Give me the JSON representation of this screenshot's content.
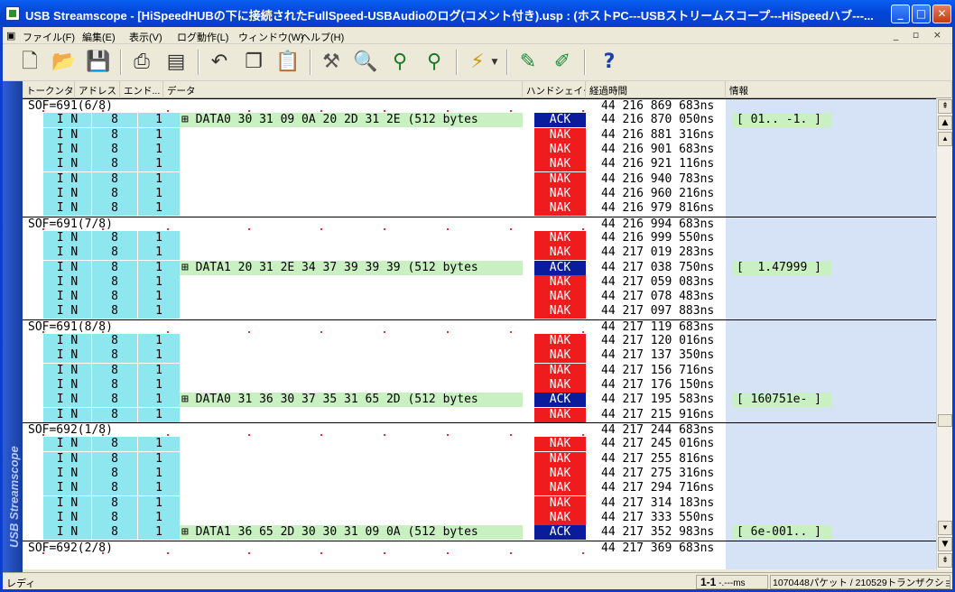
{
  "window": {
    "title": "USB Streamscope - [HiSpeedHUBの下に接続されたFullSpeed-USBAudioのログ(コメント付き).usp : (ホストPC---USBストリームスコープ---HiSpeedハブ---...",
    "min_label": "_",
    "max_label": "□",
    "close_label": "✕"
  },
  "menu": {
    "items": [
      "ファイル(F)",
      "編集(E)",
      "表示(V)",
      "ログ動作(L)",
      "ウィンドウ(W)",
      "ヘルプ(H)"
    ],
    "mdi_controls": "_ ▫ ×"
  },
  "toolbar": {
    "icons": [
      "new-icon",
      "open-icon",
      "save-icon",
      "print-icon",
      "print-preview-icon",
      "undo-icon",
      "copy-icon",
      "paste-icon",
      "filter-icon",
      "find-icon",
      "find-prev-icon",
      "find-next-icon",
      "trigger-icon",
      "mark-icon",
      "clear-mark-icon",
      "help-icon"
    ],
    "help_glyph": "?"
  },
  "sidebar": {
    "label": "USB Streamscope"
  },
  "columns": [
    "トークンタイプ",
    "アドレス",
    "エンド...",
    "データ",
    "ハンドシェイク",
    "経過時間",
    "情報"
  ],
  "rows": [
    {
      "kind": "sof",
      "label": "SOF=691(6/8)",
      "time": "44 216 869 683ns"
    },
    {
      "kind": "tx",
      "tok": "I N",
      "adr": "8",
      "end": "1",
      "data": "⊞ DATA0 30 31 09 0A 20 2D 31 2E (512 bytes",
      "hs": "ACK",
      "time": "44 216 870 050ns",
      "info": "[ 01.. -1. ]"
    },
    {
      "kind": "tx",
      "tok": "I N",
      "adr": "8",
      "end": "1",
      "hs": "NAK",
      "time": "44 216 881 316ns"
    },
    {
      "kind": "tx",
      "tok": "I N",
      "adr": "8",
      "end": "1",
      "hs": "NAK",
      "time": "44 216 901 683ns"
    },
    {
      "kind": "tx",
      "tok": "I N",
      "adr": "8",
      "end": "1",
      "hs": "NAK",
      "time": "44 216 921 116ns"
    },
    {
      "kind": "tx",
      "tok": "I N",
      "adr": "8",
      "end": "1",
      "hs": "NAK",
      "time": "44 216 940 783ns"
    },
    {
      "kind": "tx",
      "tok": "I N",
      "adr": "8",
      "end": "1",
      "hs": "NAK",
      "time": "44 216 960 216ns"
    },
    {
      "kind": "tx",
      "tok": "I N",
      "adr": "8",
      "end": "1",
      "hs": "NAK",
      "time": "44 216 979 816ns"
    },
    {
      "kind": "sof",
      "label": "SOF=691(7/8)",
      "time": "44 216 994 683ns"
    },
    {
      "kind": "tx",
      "tok": "I N",
      "adr": "8",
      "end": "1",
      "hs": "NAK",
      "time": "44 216 999 550ns"
    },
    {
      "kind": "tx",
      "tok": "I N",
      "adr": "8",
      "end": "1",
      "hs": "NAK",
      "time": "44 217 019 283ns"
    },
    {
      "kind": "tx",
      "tok": "I N",
      "adr": "8",
      "end": "1",
      "data": "⊞ DATA1 20 31 2E 34 37 39 39 39 (512 bytes",
      "hs": "ACK",
      "time": "44 217 038 750ns",
      "info": "[  1.47999 ]"
    },
    {
      "kind": "tx",
      "tok": "I N",
      "adr": "8",
      "end": "1",
      "hs": "NAK",
      "time": "44 217 059 083ns"
    },
    {
      "kind": "tx",
      "tok": "I N",
      "adr": "8",
      "end": "1",
      "hs": "NAK",
      "time": "44 217 078 483ns"
    },
    {
      "kind": "tx",
      "tok": "I N",
      "adr": "8",
      "end": "1",
      "hs": "NAK",
      "time": "44 217 097 883ns"
    },
    {
      "kind": "sof",
      "label": "SOF=691(8/8)",
      "time": "44 217 119 683ns"
    },
    {
      "kind": "tx",
      "tok": "I N",
      "adr": "8",
      "end": "1",
      "hs": "NAK",
      "time": "44 217 120 016ns"
    },
    {
      "kind": "tx",
      "tok": "I N",
      "adr": "8",
      "end": "1",
      "hs": "NAK",
      "time": "44 217 137 350ns"
    },
    {
      "kind": "tx",
      "tok": "I N",
      "adr": "8",
      "end": "1",
      "hs": "NAK",
      "time": "44 217 156 716ns"
    },
    {
      "kind": "tx",
      "tok": "I N",
      "adr": "8",
      "end": "1",
      "hs": "NAK",
      "time": "44 217 176 150ns"
    },
    {
      "kind": "tx",
      "tok": "I N",
      "adr": "8",
      "end": "1",
      "data": "⊞ DATA0 31 36 30 37 35 31 65 2D (512 bytes",
      "hs": "ACK",
      "time": "44 217 195 583ns",
      "info": "[ 160751e- ]"
    },
    {
      "kind": "tx",
      "tok": "I N",
      "adr": "8",
      "end": "1",
      "hs": "NAK",
      "time": "44 217 215 916ns"
    },
    {
      "kind": "sof",
      "label": "SOF=692(1/8)",
      "time": "44 217 244 683ns"
    },
    {
      "kind": "tx",
      "tok": "I N",
      "adr": "8",
      "end": "1",
      "hs": "NAK",
      "time": "44 217 245 016ns"
    },
    {
      "kind": "tx",
      "tok": "I N",
      "adr": "8",
      "end": "1",
      "hs": "NAK",
      "time": "44 217 255 816ns"
    },
    {
      "kind": "tx",
      "tok": "I N",
      "adr": "8",
      "end": "1",
      "hs": "NAK",
      "time": "44 217 275 316ns"
    },
    {
      "kind": "tx",
      "tok": "I N",
      "adr": "8",
      "end": "1",
      "hs": "NAK",
      "time": "44 217 294 716ns"
    },
    {
      "kind": "tx",
      "tok": "I N",
      "adr": "8",
      "end": "1",
      "hs": "NAK",
      "time": "44 217 314 183ns"
    },
    {
      "kind": "tx",
      "tok": "I N",
      "adr": "8",
      "end": "1",
      "hs": "NAK",
      "time": "44 217 333 550ns"
    },
    {
      "kind": "tx",
      "tok": "I N",
      "adr": "8",
      "end": "1",
      "data": "⊞ DATA1 36 65 2D 30 30 31 09 0A (512 bytes",
      "hs": "ACK",
      "time": "44 217 352 983ns",
      "info": "[ 6e-001.. ]"
    },
    {
      "kind": "sof",
      "label": "SOF=692(2/8)",
      "time": "44 217 369 683ns"
    }
  ],
  "colors": {
    "nak": "#ee1c1c",
    "ack": "#0a1c9c",
    "token": "#8ee6ee",
    "data": "#c8f0c0",
    "info_bg": "#d6e3f6"
  },
  "status": {
    "left": "レディ",
    "position_bold": "1-1",
    "position_suffix": " -.---ms",
    "counts": "1070448パケット / 210529トランザクション"
  }
}
